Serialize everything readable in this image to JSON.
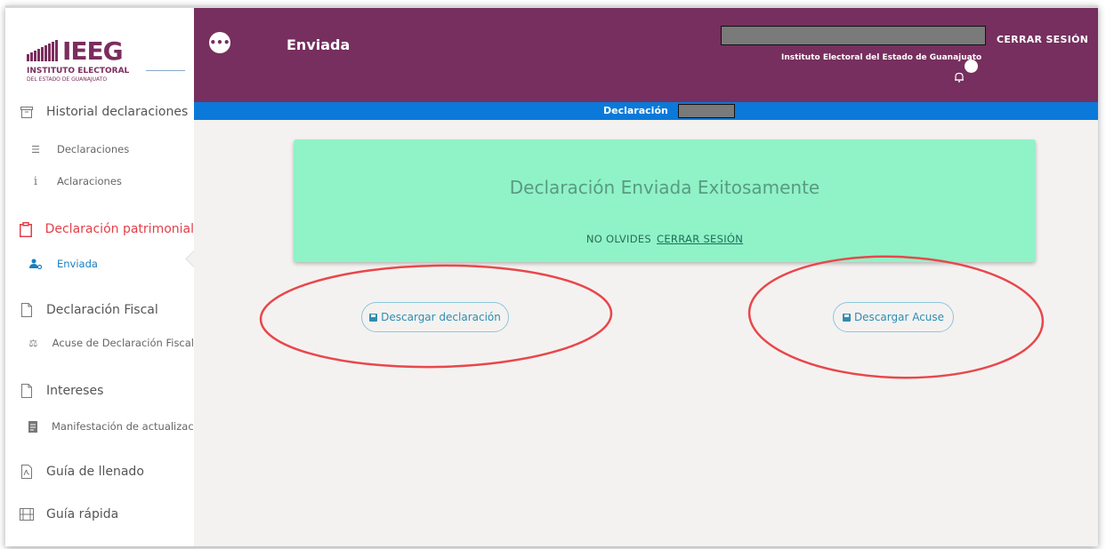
{
  "sidebar": {
    "logo": {
      "text": "IEEG",
      "line1": "INSTITUTO ELECTORAL",
      "line2": "DEL ESTADO DE GUANAJUATO"
    },
    "items": [
      {
        "label": "Historial declaraciones",
        "icon": "archive-icon",
        "kind": "section"
      },
      {
        "label": "Declaraciones",
        "icon": "list-icon",
        "kind": "sub"
      },
      {
        "label": "Aclaraciones",
        "icon": "info-icon",
        "kind": "sub"
      },
      {
        "label": "Declaración patrimonial",
        "icon": "clipboard-icon",
        "kind": "section",
        "active": true
      },
      {
        "label": "Enviada",
        "icon": "user-gear-icon",
        "kind": "sub",
        "active": true
      },
      {
        "label": "Declaración Fiscal",
        "icon": "file-icon",
        "kind": "section"
      },
      {
        "label": "Acuse de Declaración Fiscal",
        "icon": "scale-icon",
        "kind": "sub"
      },
      {
        "label": "Intereses",
        "icon": "file-icon",
        "kind": "section"
      },
      {
        "label": "Manifestación de actualizaci",
        "icon": "file-text-icon",
        "kind": "sub"
      },
      {
        "label": "Guía de llenado",
        "icon": "pdf-icon",
        "kind": "section"
      },
      {
        "label": "Guía rápida",
        "icon": "film-icon",
        "kind": "section"
      }
    ]
  },
  "header": {
    "title": "Enviada",
    "org": "Instituto Electoral del Estado de Guanajuato",
    "logout": "CERRAR SESIÓN",
    "menu_glyph": "•••"
  },
  "subheader": {
    "label": "Declaración"
  },
  "alert": {
    "title": "Declaración Enviada Exitosamente",
    "reminder": "NO OLVIDES",
    "link": "CERRAR SESIÓN"
  },
  "buttons": {
    "download_declaration": "Descargar declaración",
    "download_receipt": "Descargar Acuse"
  },
  "colors": {
    "header": "#762f5e",
    "bluebar": "#0b79d9",
    "alert": "#8ff3c7",
    "active_section": "#e23f48",
    "active_item": "#1a7fc0",
    "annotation": "#e8474c"
  }
}
